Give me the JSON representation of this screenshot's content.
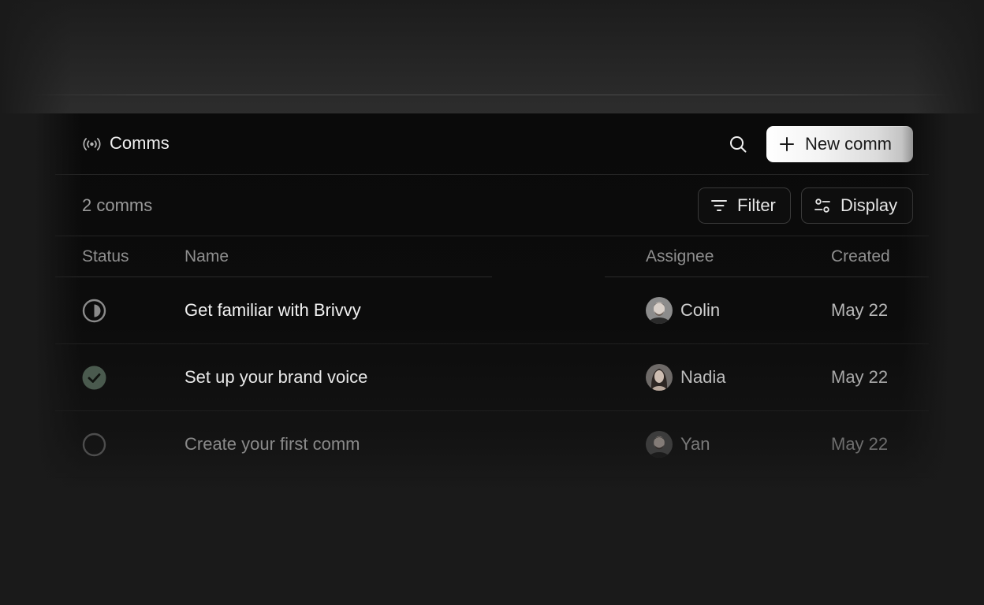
{
  "header": {
    "title": "Comms",
    "title_icon": "broadcast-icon",
    "search_icon": "search-icon",
    "new_button_label": "New comm"
  },
  "toolbar": {
    "count_label": "2 comms",
    "filter_label": "Filter",
    "display_label": "Display"
  },
  "columns": {
    "status": "Status",
    "name": "Name",
    "assignee": "Assignee",
    "created": "Created"
  },
  "rows": [
    {
      "status": "in-progress",
      "name": "Get familiar with Brivvy",
      "assignee": "Colin",
      "created": "May 22"
    },
    {
      "status": "done",
      "name": "Set up your brand voice",
      "assignee": "Nadia",
      "created": "May 22"
    },
    {
      "status": "todo",
      "name": "Create your first comm",
      "assignee": "Yan",
      "created": "May 22"
    }
  ],
  "colors": {
    "background": "#1a1a1a",
    "panel": "#0a0a0a",
    "primary_button": "#f4f4f4",
    "done_check": "#4a5a4e"
  }
}
